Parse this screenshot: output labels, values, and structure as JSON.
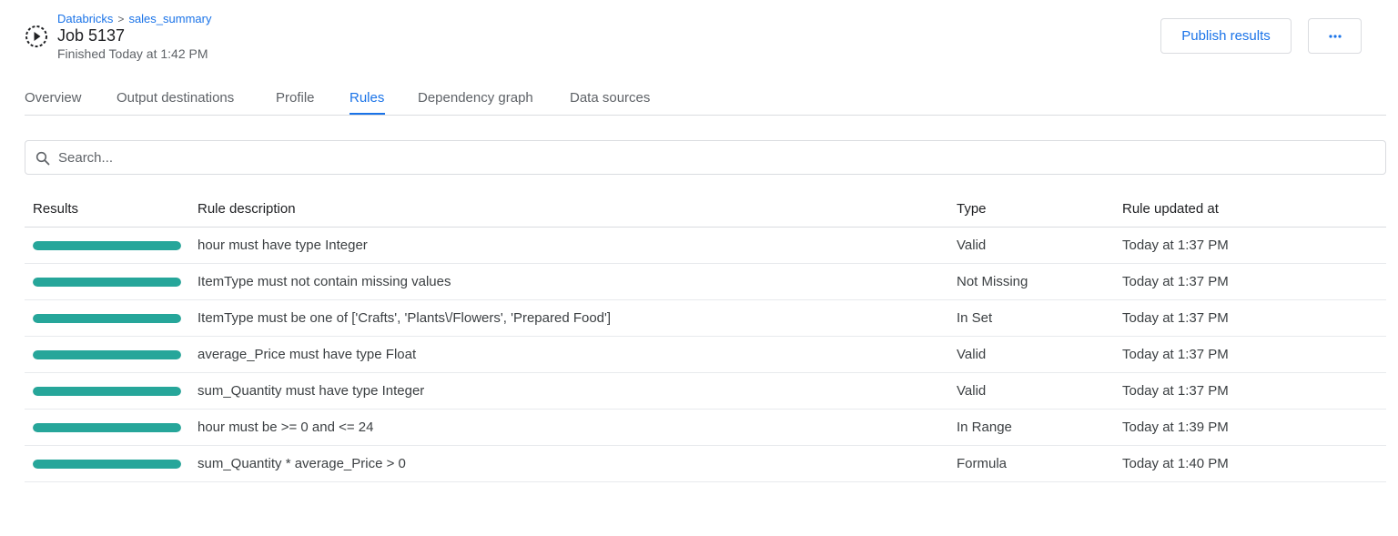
{
  "header": {
    "breadcrumb": [
      "Databricks",
      "sales_summary"
    ],
    "breadcrumb_separator": ">",
    "title": "Job 5137",
    "status": "Finished Today at 1:42 PM",
    "job_icon": "play-circle-icon",
    "publish_label": "Publish results",
    "more_label": "···"
  },
  "tabs": [
    {
      "label": "Overview",
      "active": false
    },
    {
      "label": "Output destinations",
      "active": false
    },
    {
      "label": "Profile",
      "active": false
    },
    {
      "label": "Rules",
      "active": true
    },
    {
      "label": "Dependency graph",
      "active": false
    },
    {
      "label": "Data sources",
      "active": false
    }
  ],
  "search": {
    "placeholder": "Search...",
    "value": "",
    "icon": "search-icon"
  },
  "table": {
    "columns": [
      "Results",
      "Rule description",
      "Type",
      "Rule updated at"
    ],
    "rows": [
      {
        "result_pass_fraction": 1.0,
        "description": "hour must have type Integer",
        "type": "Valid",
        "updated": "Today at 1:37 PM"
      },
      {
        "result_pass_fraction": 1.0,
        "description": "ItemType must not contain missing values",
        "type": "Not Missing",
        "updated": "Today at 1:37 PM"
      },
      {
        "result_pass_fraction": 1.0,
        "description": "ItemType must be one of ['Crafts', 'Plants\\/Flowers', 'Prepared Food']",
        "type": "In Set",
        "updated": "Today at 1:37 PM"
      },
      {
        "result_pass_fraction": 1.0,
        "description": "average_Price must have type Float",
        "type": "Valid",
        "updated": "Today at 1:37 PM"
      },
      {
        "result_pass_fraction": 1.0,
        "description": "sum_Quantity must have type Integer",
        "type": "Valid",
        "updated": "Today at 1:37 PM"
      },
      {
        "result_pass_fraction": 1.0,
        "description": "hour must be >= 0 and <= 24",
        "type": "In Range",
        "updated": "Today at 1:39 PM"
      },
      {
        "result_pass_fraction": 1.0,
        "description": "sum_Quantity * average_Price > 0",
        "type": "Formula",
        "updated": "Today at 1:40 PM"
      }
    ]
  },
  "colors": {
    "accent": "#1a73e8",
    "result_pass": "#26a69a"
  }
}
